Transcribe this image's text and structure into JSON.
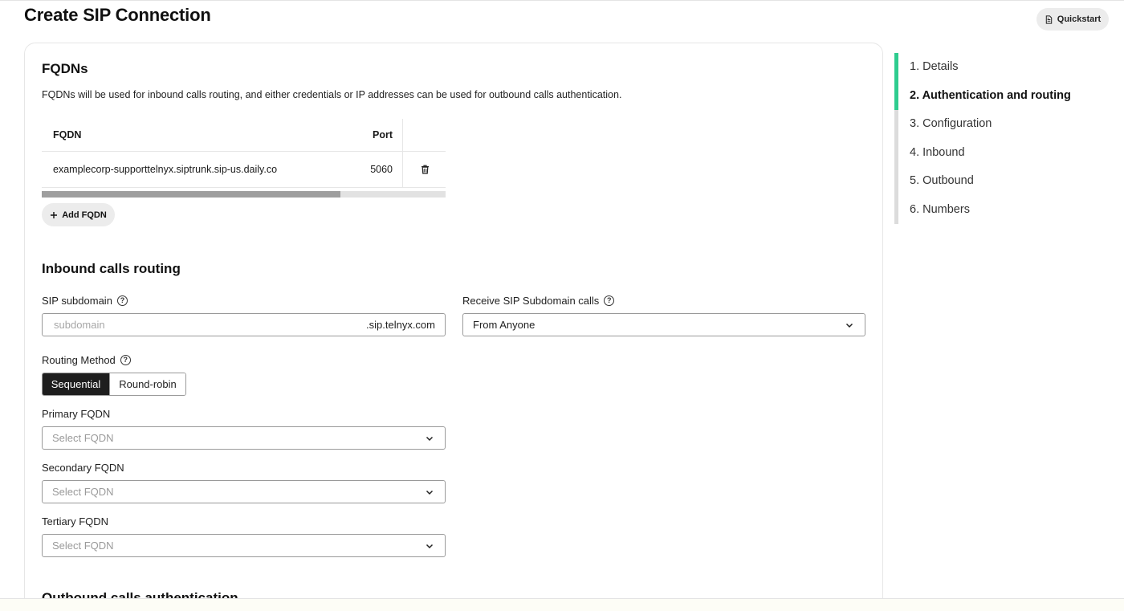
{
  "page": {
    "title": "Create SIP Connection",
    "quickstart_label": "Quickstart"
  },
  "fqdns": {
    "title": "FQDNs",
    "description": "FQDNs will be used for inbound calls routing, and either credentials or IP addresses can be used for outbound calls authentication.",
    "table": {
      "columns": [
        "FQDN",
        "Port"
      ],
      "rows": [
        {
          "fqdn": "examplecorp-supporttelnyx.siptrunk.sip-us.daily.co",
          "port": "5060"
        }
      ]
    },
    "add_label": "Add FQDN"
  },
  "inbound": {
    "title": "Inbound calls routing",
    "sip_subdomain": {
      "label": "SIP subdomain",
      "placeholder": "subdomain",
      "value": "",
      "suffix": ".sip.telnyx.com"
    },
    "receive_calls": {
      "label": "Receive SIP Subdomain calls",
      "value": "From Anyone"
    },
    "routing_method": {
      "label": "Routing Method",
      "options": [
        "Sequential",
        "Round-robin"
      ],
      "selected": "Sequential"
    },
    "primary": {
      "label": "Primary FQDN",
      "placeholder": "Select FQDN"
    },
    "secondary": {
      "label": "Secondary FQDN",
      "placeholder": "Select FQDN"
    },
    "tertiary": {
      "label": "Tertiary FQDN",
      "placeholder": "Select FQDN"
    }
  },
  "outbound": {
    "title": "Outbound calls authentication"
  },
  "steps": {
    "items": [
      "1. Details",
      "2. Authentication and routing",
      "3. Configuration",
      "4. Inbound",
      "5. Outbound",
      "6. Numbers"
    ],
    "active_index": 1
  },
  "colors": {
    "accent": "#2ecc8f",
    "segment_active": "#1e1e1e",
    "chip_bg": "#ececec"
  },
  "table_scroll_fraction": 0.74
}
